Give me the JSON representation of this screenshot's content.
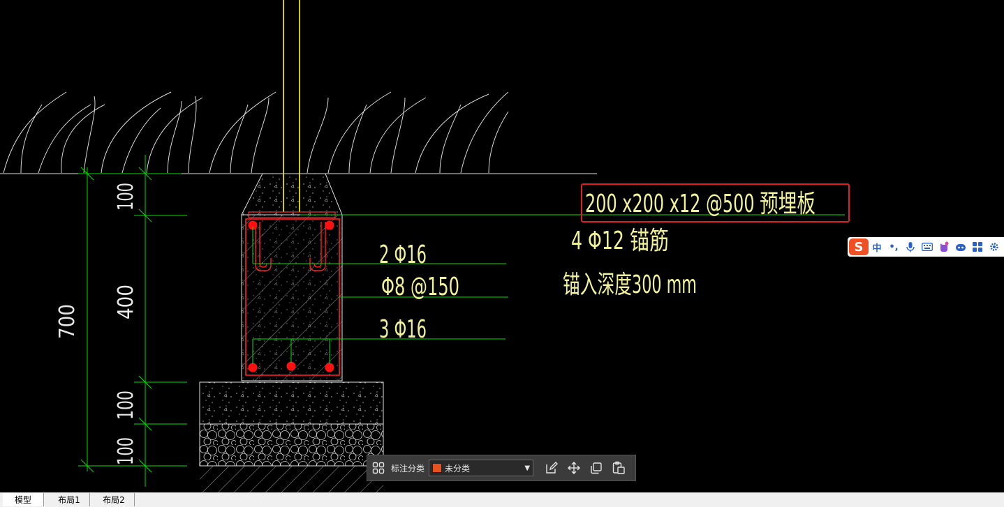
{
  "drawing": {
    "callout_highlight": "200 x200 x12 @500 预埋板",
    "callout_anchor": "4 Φ12   锚筋",
    "callout_depth": "锚入深度300 mm",
    "rebar_top": "2 Φ16",
    "rebar_stirrup": "Φ8 @150",
    "rebar_bottom": "3 Φ16",
    "dim_total": "700",
    "dim_top": "100",
    "dim_middle": "400",
    "dim_base1": "100",
    "dim_base2": "100",
    "colors": {
      "background": "#000000",
      "text": "#f2f29b",
      "dimension_line": "#00ff00",
      "rebar": "#ff0000",
      "highlight_box": "#e02020",
      "pipe": "#ffff00"
    }
  },
  "annotation_toolbar": {
    "grid_icon": "grid-icon",
    "category_label": "标注分类",
    "category_value": "未分类",
    "category_color": "#e8501e",
    "icons": [
      "edit-icon",
      "move-icon",
      "copy-icon",
      "paste-icon"
    ]
  },
  "ime_bar": {
    "logo": "S",
    "lang": "中",
    "punct": "•,",
    "icons": [
      "mic-icon",
      "keyboard-icon",
      "skin-icon",
      "robot-icon",
      "apps-icon",
      "settings-icon"
    ]
  },
  "tabs": [
    {
      "label": "模型"
    },
    {
      "label": "布局1"
    },
    {
      "label": "布局2"
    }
  ]
}
